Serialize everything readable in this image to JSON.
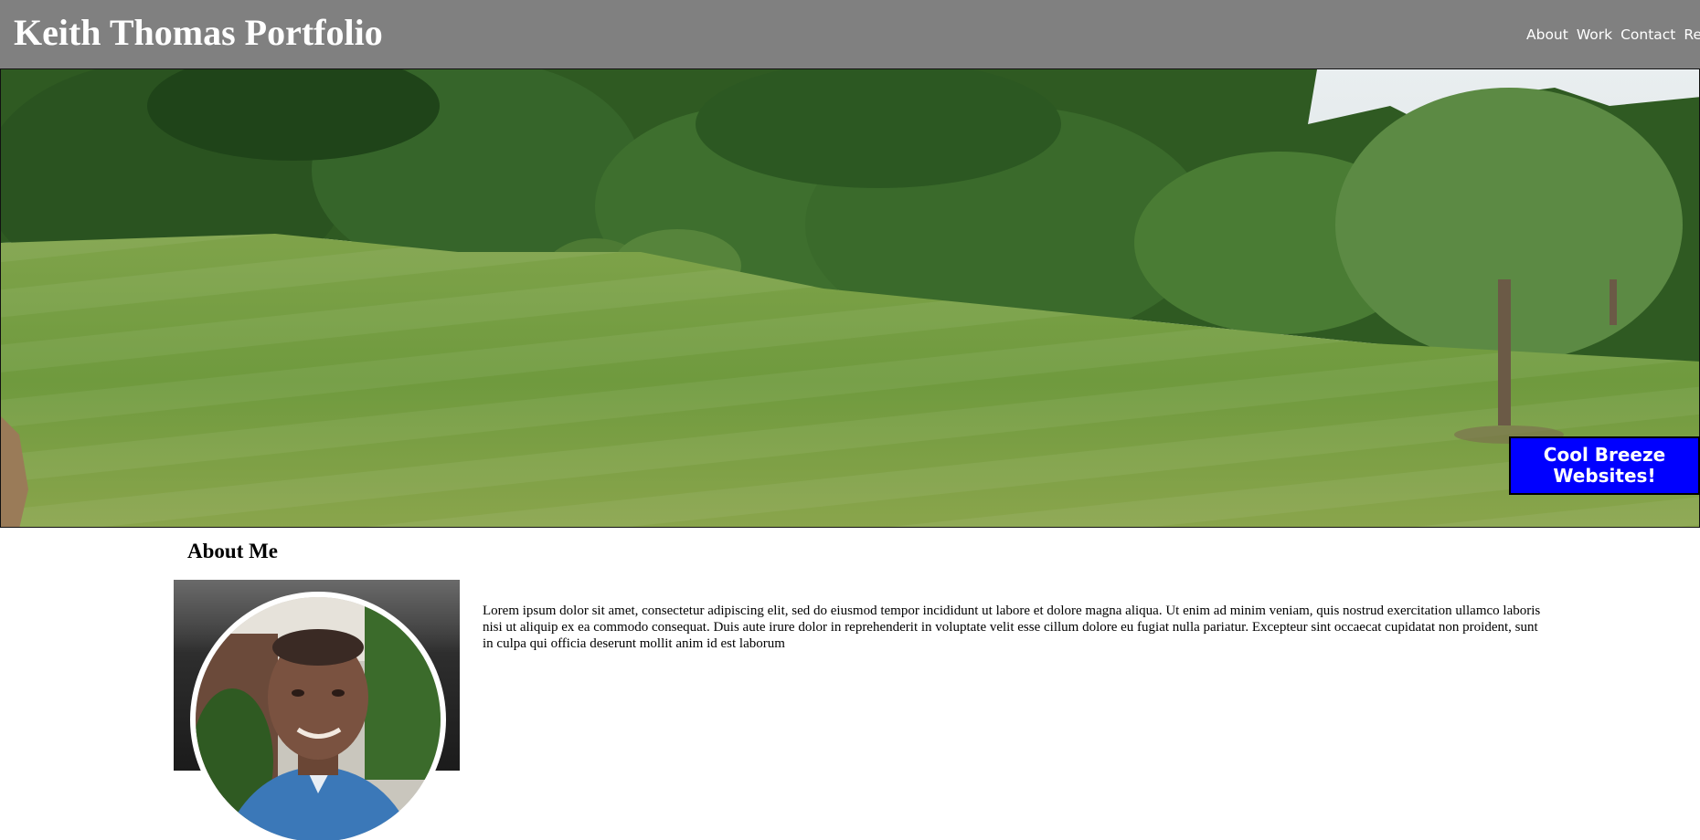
{
  "header": {
    "title": "Keith Thomas Portfolio",
    "nav": [
      "About",
      "Work",
      "Contact",
      "Resume"
    ]
  },
  "hero": {
    "cta_line1": "Cool Breeze",
    "cta_line2": "Websites!",
    "cta_color": "#0000ff"
  },
  "about": {
    "heading": "About Me",
    "body": "Lorem ipsum dolor sit amet, consectetur adipiscing elit, sed do eiusmod tempor incididunt ut labore et dolore magna aliqua. Ut enim ad minim veniam, quis nostrud exercitation ullamco laboris nisi ut aliquip ex ea commodo consequat. Duis aute irure dolor in reprehenderit in voluptate velit esse cillum dolore eu fugiat nulla pariatur. Excepteur sint occaecat cupidatat non proident, sunt in culpa qui officia deserunt mollit anim id est laborum"
  },
  "colors": {
    "header_bg": "#808080",
    "cta_bg": "#0000ff"
  }
}
